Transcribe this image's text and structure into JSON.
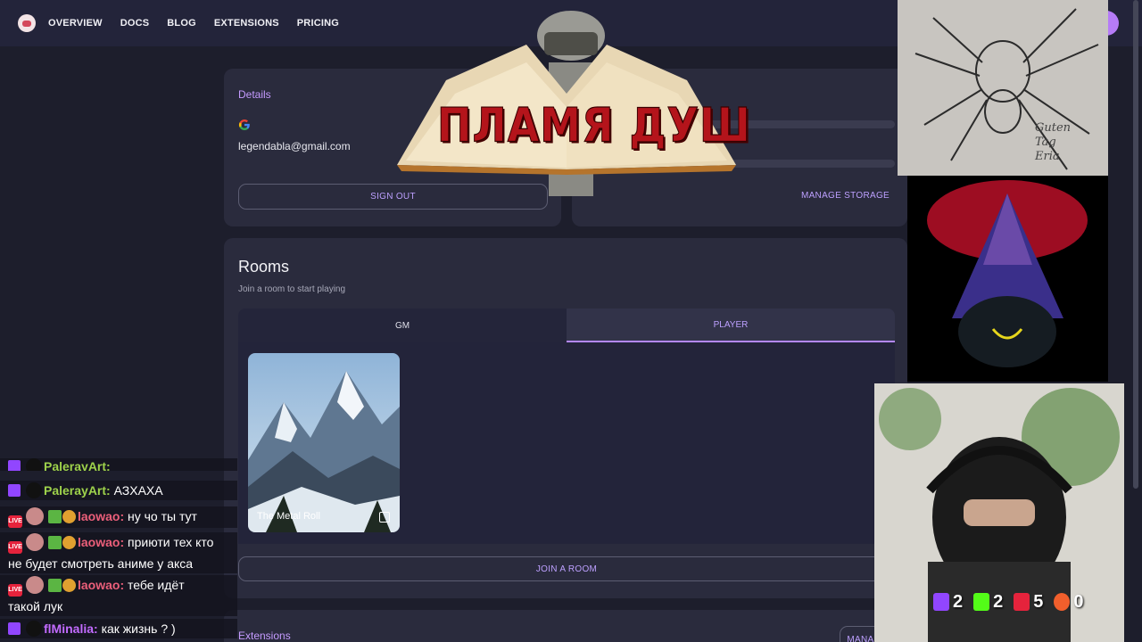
{
  "nav": {
    "items": [
      "OVERVIEW",
      "DOCS",
      "BLOG",
      "EXTENSIONS",
      "PRICING"
    ]
  },
  "details": {
    "title": "Details",
    "email": "legendabla@gmail.com",
    "sign_out": "SIGN OUT"
  },
  "storage": {
    "manage": "MANAGE STORAGE"
  },
  "rooms": {
    "title": "Rooms",
    "subtitle": "Join a room to start playing",
    "tabs": [
      "GM",
      "PLAYER"
    ],
    "active_tab": "PLAYER",
    "room_name": "The Metal Roll",
    "join": "JOIN A ROOM"
  },
  "extensions": {
    "title": "Extensions",
    "manage": "MANAGE"
  },
  "overlay": {
    "book_title": "ПЛАМЯ ДУШ",
    "sketch_text": [
      "Guten",
      "Tag",
      "Eria"
    ]
  },
  "chat": [
    {
      "user": "PalerayArt:",
      "msg": "",
      "platform": "twitch",
      "color": "green"
    },
    {
      "user": "PalerayArt:",
      "msg": "АЗХАХА",
      "platform": "twitch",
      "color": "green"
    },
    {
      "user": "laowao:",
      "msg": "ну чо ты тут",
      "platform": "live",
      "color": "pink"
    },
    {
      "user": "laowao:",
      "msg": "приюти тех кто",
      "msg2": "не будет смотреть аниме у акса",
      "platform": "live",
      "color": "pink"
    },
    {
      "user": "laowao:",
      "msg": "тебе идёт",
      "msg2": "такой лук",
      "platform": "live",
      "color": "pink"
    },
    {
      "user": "flMinalia:",
      "msg": "как жизнь ? )",
      "platform": "twitch",
      "color": "purple"
    }
  ],
  "viewer_counts": [
    {
      "platform": "twitch",
      "count": "2",
      "color": "#9146ff"
    },
    {
      "platform": "kick",
      "count": "2",
      "color": "#53fc18"
    },
    {
      "platform": "live",
      "count": "5",
      "color": "#e5233c"
    },
    {
      "platform": "boosty",
      "count": "0",
      "color": "#f15f2c"
    }
  ]
}
